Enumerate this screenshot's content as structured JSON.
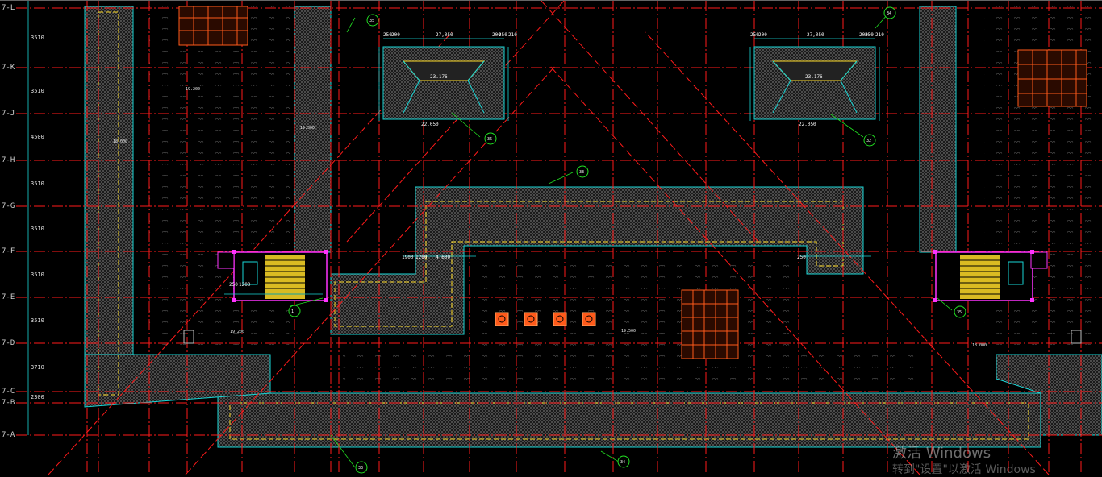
{
  "grid_rows": [
    "7-L",
    "7-K",
    "7-J",
    "7-H",
    "7-G",
    "7-F",
    "7-E",
    "7-D",
    "7-C",
    "7-B",
    "7-A"
  ],
  "row_spacings": [
    "3510",
    "3510",
    "4500",
    "3510",
    "3510",
    "3510",
    "3510",
    "3710",
    "2300"
  ],
  "dims_top_left": [
    "250",
    "200",
    "27,050",
    "200",
    "250",
    "210"
  ],
  "dims_top_right": [
    "250",
    "200",
    "27,050",
    "200",
    "250",
    "210"
  ],
  "roof_elev_left": "23.176",
  "roof_elev_right": "23.176",
  "ridge_elev_left": "22.050",
  "ridge_elev_right": "22.050",
  "stair_dims": [
    "1200",
    "250",
    "1900",
    "1200",
    "4,600",
    "250"
  ],
  "level_labels": [
    "18.000",
    "19.200",
    "19.500"
  ],
  "callouts": [
    "33",
    "34",
    "35",
    "36",
    "32",
    "1"
  ],
  "plant_items": [
    "unit-1",
    "unit-2",
    "unit-3",
    "unit-4"
  ],
  "watermark": {
    "line1": "激活 Windows",
    "line2": "转到\"设置\"以激活 Windows"
  },
  "colors": {
    "background": "#000000",
    "grid_red": "#ff1a1a",
    "wall_cyan": "#19d6d6",
    "hatch_white": "#8a8a8a",
    "stair_yellow": "#ffdc28",
    "green_text": "#22e022",
    "magenta": "#ff33ff",
    "orange_equipment": "#ff5a1a"
  }
}
